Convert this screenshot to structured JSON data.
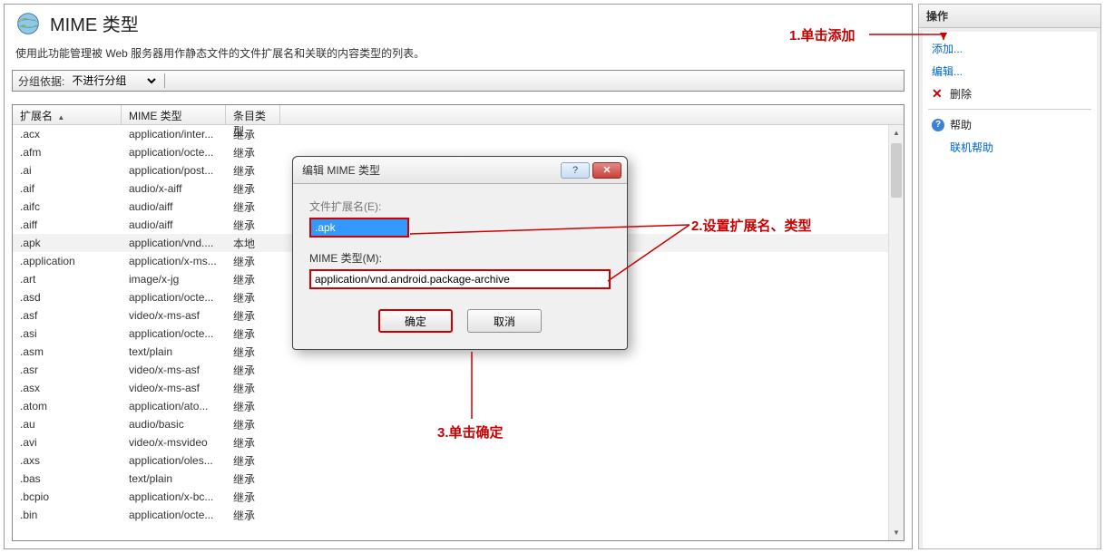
{
  "header": {
    "title": "MIME 类型",
    "description": "使用此功能管理被 Web 服务器用作静态文件的文件扩展名和关联的内容类型的列表。"
  },
  "grouping": {
    "label": "分组依据:",
    "value": "不进行分组"
  },
  "columns": {
    "ext": "扩展名",
    "mime": "MIME 类型",
    "type": "条目类型"
  },
  "rows": [
    {
      "ext": ".acx",
      "mime": "application/inter...",
      "type": "继承",
      "selected": false
    },
    {
      "ext": ".afm",
      "mime": "application/octe...",
      "type": "继承",
      "selected": false
    },
    {
      "ext": ".ai",
      "mime": "application/post...",
      "type": "继承",
      "selected": false
    },
    {
      "ext": ".aif",
      "mime": "audio/x-aiff",
      "type": "继承",
      "selected": false
    },
    {
      "ext": ".aifc",
      "mime": "audio/aiff",
      "type": "继承",
      "selected": false
    },
    {
      "ext": ".aiff",
      "mime": "audio/aiff",
      "type": "继承",
      "selected": false
    },
    {
      "ext": ".apk",
      "mime": "application/vnd....",
      "type": "本地",
      "selected": true
    },
    {
      "ext": ".application",
      "mime": "application/x-ms...",
      "type": "继承",
      "selected": false
    },
    {
      "ext": ".art",
      "mime": "image/x-jg",
      "type": "继承",
      "selected": false
    },
    {
      "ext": ".asd",
      "mime": "application/octe...",
      "type": "继承",
      "selected": false
    },
    {
      "ext": ".asf",
      "mime": "video/x-ms-asf",
      "type": "继承",
      "selected": false
    },
    {
      "ext": ".asi",
      "mime": "application/octe...",
      "type": "继承",
      "selected": false
    },
    {
      "ext": ".asm",
      "mime": "text/plain",
      "type": "继承",
      "selected": false
    },
    {
      "ext": ".asr",
      "mime": "video/x-ms-asf",
      "type": "继承",
      "selected": false
    },
    {
      "ext": ".asx",
      "mime": "video/x-ms-asf",
      "type": "继承",
      "selected": false
    },
    {
      "ext": ".atom",
      "mime": "application/ato...",
      "type": "继承",
      "selected": false
    },
    {
      "ext": ".au",
      "mime": "audio/basic",
      "type": "继承",
      "selected": false
    },
    {
      "ext": ".avi",
      "mime": "video/x-msvideo",
      "type": "继承",
      "selected": false
    },
    {
      "ext": ".axs",
      "mime": "application/oles...",
      "type": "继承",
      "selected": false
    },
    {
      "ext": ".bas",
      "mime": "text/plain",
      "type": "继承",
      "selected": false
    },
    {
      "ext": ".bcpio",
      "mime": "application/x-bc...",
      "type": "继承",
      "selected": false
    },
    {
      "ext": ".bin",
      "mime": "application/octe...",
      "type": "继承",
      "selected": false
    }
  ],
  "actions": {
    "title": "操作",
    "add": "添加...",
    "edit": "编辑...",
    "delete": "删除",
    "help": "帮助",
    "online_help": "联机帮助"
  },
  "dialog": {
    "title": "编辑 MIME 类型",
    "ext_label": "文件扩展名(E):",
    "ext_value": ".apk",
    "mime_label": "MIME 类型(M):",
    "mime_value": "application/vnd.android.package-archive",
    "ok": "确定",
    "cancel": "取消",
    "help_btn": "?",
    "close_btn": "✕"
  },
  "annotations": {
    "a1": "1.单击添加",
    "a2": "2.设置扩展名、类型",
    "a3": "3.单击确定"
  }
}
